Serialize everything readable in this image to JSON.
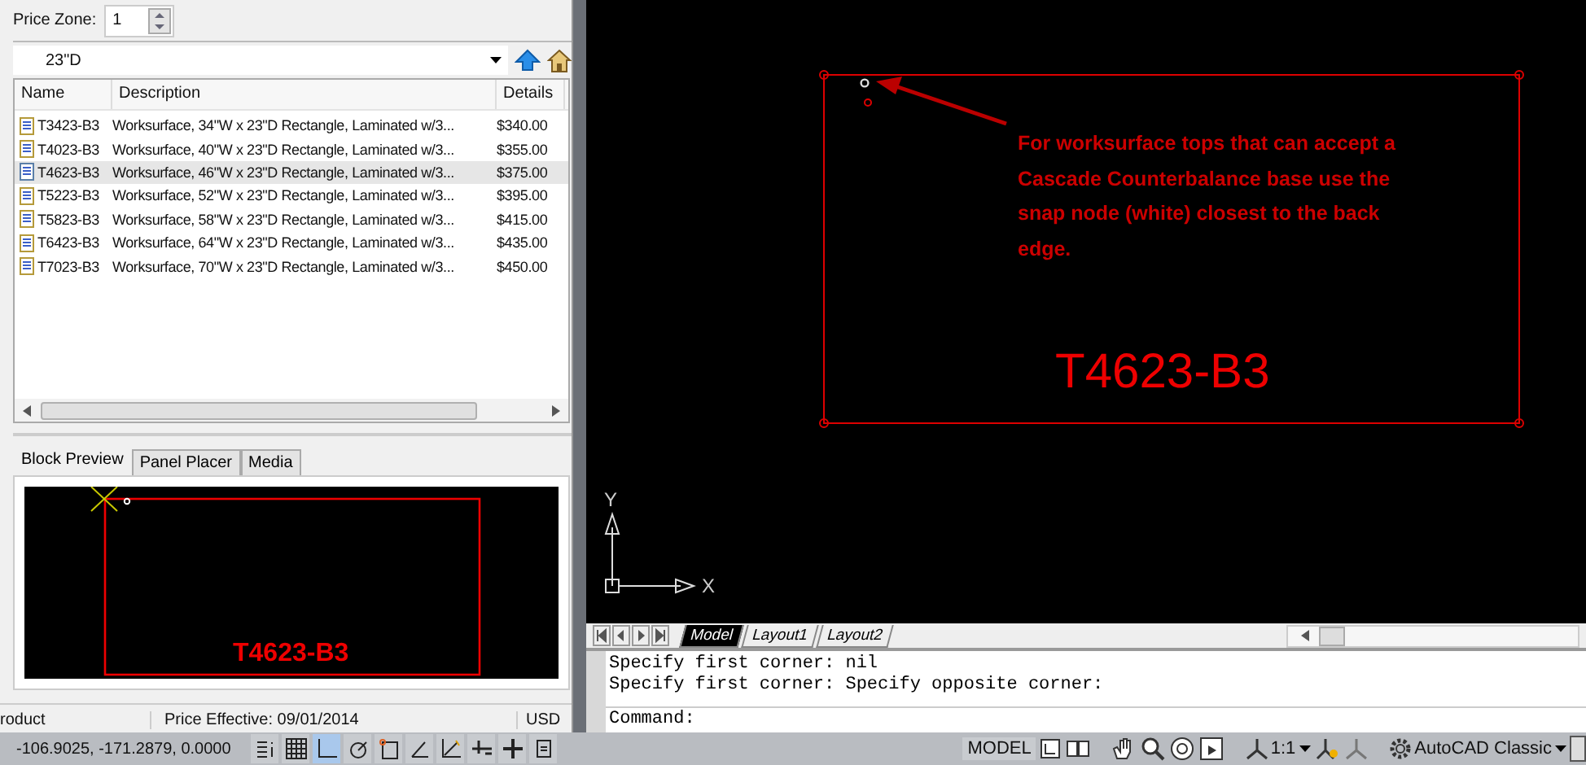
{
  "left_panel": {
    "price_zone": {
      "label": "Price Zone:",
      "value": "1"
    },
    "folder_dropdown": {
      "value": "23\"D"
    },
    "table": {
      "columns": [
        "Name",
        "Description",
        "Details"
      ],
      "rows": [
        {
          "name": "T3423-B3",
          "description": "Worksurface, 34\"W x 23\"D Rectangle, Laminated w/3...",
          "details": "$340.00",
          "selected": false
        },
        {
          "name": "T4023-B3",
          "description": "Worksurface, 40\"W x 23\"D Rectangle, Laminated w/3...",
          "details": "$355.00",
          "selected": false
        },
        {
          "name": "T4623-B3",
          "description": "Worksurface, 46\"W x 23\"D Rectangle, Laminated w/3...",
          "details": "$375.00",
          "selected": true
        },
        {
          "name": "T5223-B3",
          "description": "Worksurface, 52\"W x 23\"D Rectangle, Laminated w/3...",
          "details": "$395.00",
          "selected": false
        },
        {
          "name": "T5823-B3",
          "description": "Worksurface, 58\"W x 23\"D Rectangle, Laminated w/3...",
          "details": "$415.00",
          "selected": false
        },
        {
          "name": "T6423-B3",
          "description": "Worksurface, 64\"W x 23\"D Rectangle, Laminated w/3...",
          "details": "$435.00",
          "selected": false
        },
        {
          "name": "T7023-B3",
          "description": "Worksurface, 70\"W x 23\"D Rectangle, Laminated w/3...",
          "details": "$450.00",
          "selected": false
        }
      ]
    },
    "tabs": [
      {
        "label": "Block Preview",
        "selected": true
      },
      {
        "label": "Panel Placer",
        "selected": false
      },
      {
        "label": "Media",
        "selected": false
      }
    ],
    "preview": {
      "block_label": "T4623-B3"
    },
    "status": {
      "product": "roduct",
      "price_effective": "Price Effective: 09/01/2014",
      "currency": "USD"
    }
  },
  "canvas": {
    "annotation": "For worksurface tops that can accept a Cascade Counterbalance base use the snap node (white) closest to the back edge.",
    "block_label": "T4623-B3",
    "axis_y": "Y",
    "axis_x": "X"
  },
  "layout_tabs": [
    {
      "label": "Model",
      "selected": true
    },
    {
      "label": "Layout1",
      "selected": false
    },
    {
      "label": "Layout2",
      "selected": false
    }
  ],
  "command_history": [
    "Specify first corner: nil",
    "Specify first corner: Specify opposite corner:"
  ],
  "command_prompt": "Command:",
  "status_bar": {
    "coordinates": "-106.9025, -171.2879, 0.0000",
    "toggles": [
      {
        "kind": "infer",
        "on": false
      },
      {
        "kind": "grid",
        "on": false
      },
      {
        "kind": "ortho",
        "on": true
      },
      {
        "kind": "polar",
        "on": false
      },
      {
        "kind": "osnap",
        "on": false
      },
      {
        "kind": "angle",
        "on": false
      },
      {
        "kind": "dynamic",
        "on": false
      },
      {
        "kind": "lineweight",
        "on": false
      },
      {
        "kind": "cross",
        "on": false
      },
      {
        "kind": "properties",
        "on": false
      }
    ],
    "model": "MODEL",
    "scale": "1:1",
    "workspace": "AutoCAD Classic"
  }
}
